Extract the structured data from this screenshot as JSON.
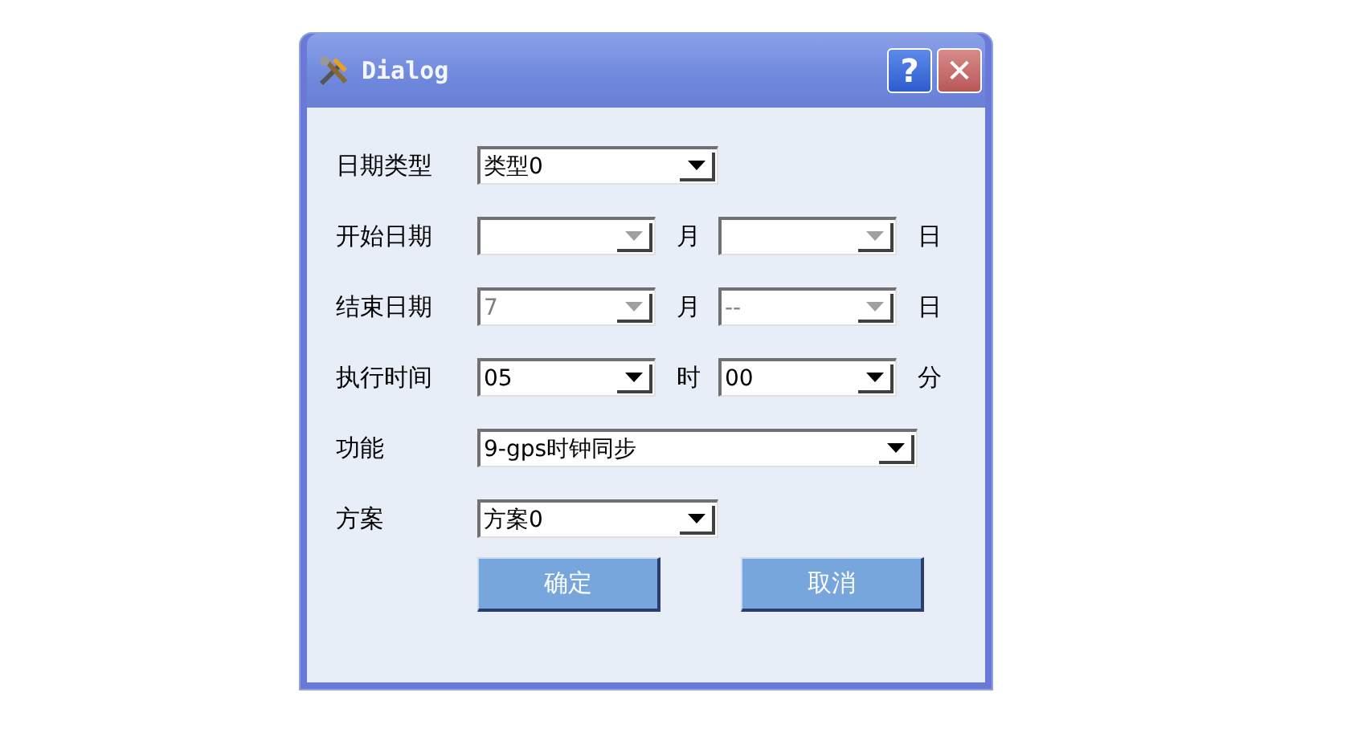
{
  "window": {
    "title": "Dialog",
    "help": "?",
    "close": "✕"
  },
  "rows": [
    {
      "label": "日期类型",
      "fields": [
        {
          "kind": "medium",
          "value": "类型0",
          "disabled": false
        }
      ]
    },
    {
      "label": "开始日期",
      "fields": [
        {
          "kind": "short",
          "disabled": true,
          "unit": "月"
        },
        {
          "kind": "short",
          "disabled": true,
          "unit": "日"
        }
      ]
    },
    {
      "label": "结束日期",
      "fields": [
        {
          "kind": "short",
          "value": "7",
          "disabled": true,
          "unit": "月"
        },
        {
          "kind": "short",
          "value": "--",
          "disabled": true,
          "unit": "日"
        }
      ]
    },
    {
      "label": "执行时间",
      "fields": [
        {
          "kind": "short",
          "value": "05",
          "disabled": false,
          "unit": "时"
        },
        {
          "kind": "short",
          "value": "00",
          "disabled": false,
          "unit": "分"
        }
      ]
    },
    {
      "label": "功能",
      "fields": [
        {
          "kind": "long",
          "value": "9-gps时钟同步",
          "disabled": false
        }
      ]
    },
    {
      "label": "方案",
      "fields": [
        {
          "kind": "medium",
          "value": "方案0",
          "disabled": false
        }
      ]
    }
  ],
  "buttons": [
    "确定",
    "取消"
  ]
}
